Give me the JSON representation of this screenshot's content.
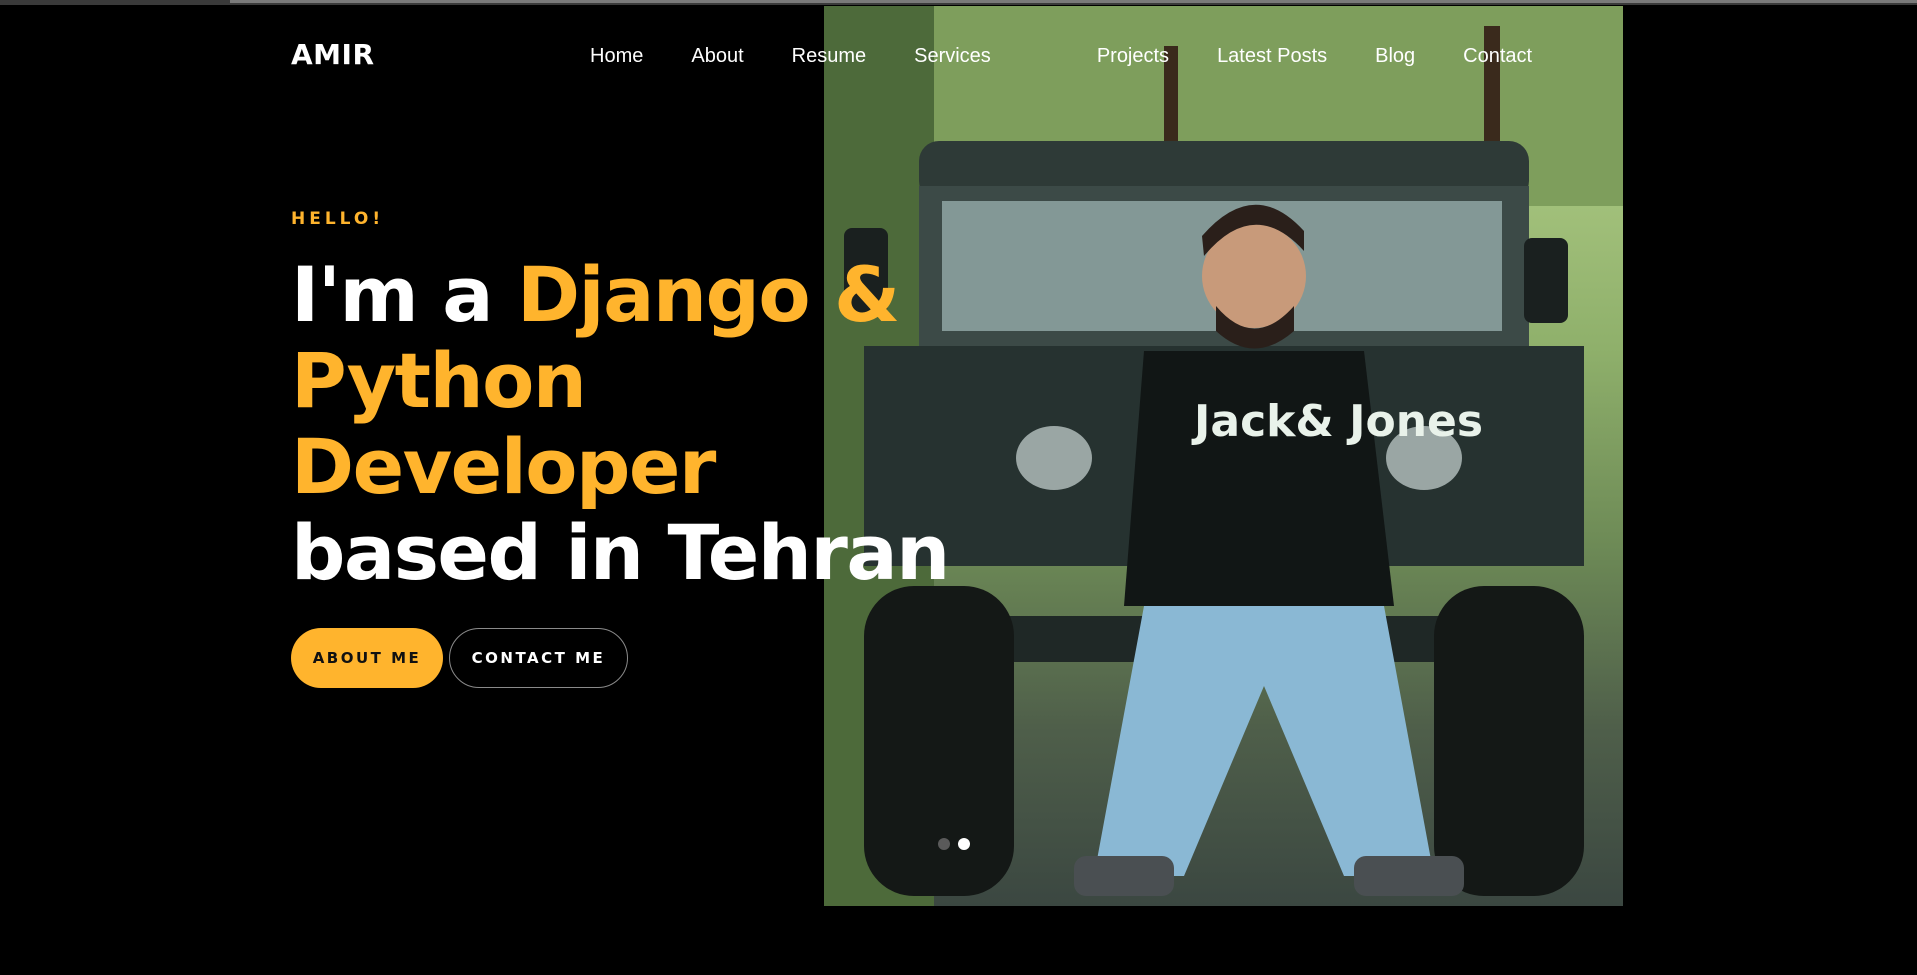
{
  "brand": {
    "name": "AMIR"
  },
  "nav": {
    "items": [
      {
        "label": "Home"
      },
      {
        "label": "About"
      },
      {
        "label": "Resume"
      },
      {
        "label": "Services"
      },
      {
        "label": "Projects"
      },
      {
        "label": "Latest Posts"
      },
      {
        "label": "Blog"
      },
      {
        "label": "Contact"
      }
    ]
  },
  "hero": {
    "eyebrow": "HELLO!",
    "headline": {
      "part1": "I'm a ",
      "accent1": "Django &",
      "accent2": "Python",
      "accent3": "Developer",
      "part2": "based in Tehran"
    },
    "buttons": {
      "primary": "ABOUT ME",
      "secondary": "CONTACT ME"
    },
    "photo_caption_text": "Jack& Jones",
    "slider": {
      "count": 2,
      "active_index": 1
    }
  },
  "colors": {
    "accent": "#ffb42d",
    "background": "#000000",
    "text": "#ffffff"
  }
}
